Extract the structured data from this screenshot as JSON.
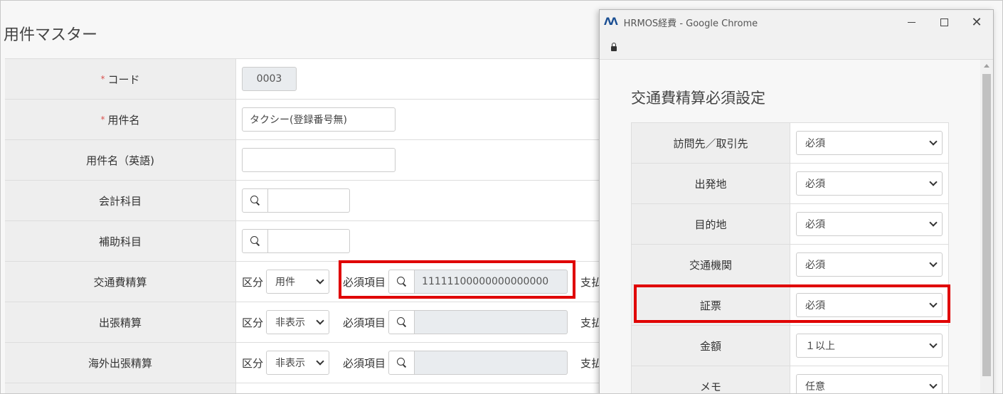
{
  "page": {
    "title": "用件マスター"
  },
  "form": {
    "code": {
      "label": "コード",
      "required_mark": "*",
      "value": "0003"
    },
    "name": {
      "label": "用件名",
      "required_mark": "*",
      "value": "タクシー(登録番号無)"
    },
    "name_en": {
      "label": "用件名（英語)",
      "value": ""
    },
    "account": {
      "label": "会計科目",
      "value": ""
    },
    "sub_account": {
      "label": "補助科目",
      "value": ""
    },
    "transport": {
      "label": "交通費精算",
      "kubun_label": "区分",
      "kubun_value": "用件",
      "hissu_label": "必須項目",
      "hissu_value": "11111100000000000000",
      "cut_label": "支払"
    },
    "trip": {
      "label": "出張精算",
      "kubun_label": "区分",
      "kubun_value": "非表示",
      "hissu_label": "必須項目",
      "hissu_value": "",
      "cut_label": "支払"
    },
    "overseas": {
      "label": "海外出張精算",
      "kubun_label": "区分",
      "kubun_value": "非表示",
      "hissu_label": "必須項目",
      "hissu_value": "",
      "cut_label": "支払"
    }
  },
  "popup": {
    "logo": "ꟽ",
    "window_title": "HRMOS経費 - Google Chrome",
    "heading": "交通費精算必須設定",
    "rows": [
      {
        "label": "訪問先／取引先",
        "value": "必須"
      },
      {
        "label": "出発地",
        "value": "必須"
      },
      {
        "label": "目的地",
        "value": "必須"
      },
      {
        "label": "交通機関",
        "value": "必須"
      },
      {
        "label": "証票",
        "value": "必須"
      },
      {
        "label": "金額",
        "value": "１以上"
      },
      {
        "label": "メモ",
        "value": "任意"
      }
    ]
  },
  "colors": {
    "highlight": "#e00000",
    "required": "#d9534f",
    "logo": "#1b4f93"
  }
}
